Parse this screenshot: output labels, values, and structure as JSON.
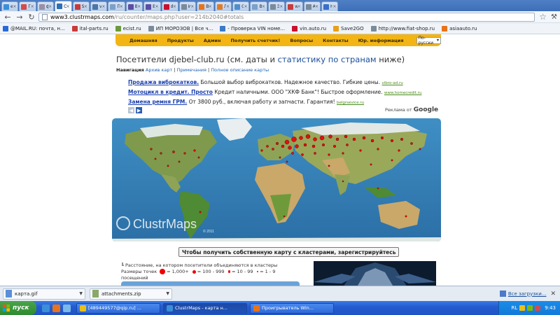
{
  "browser": {
    "tabs": [
      {
        "label": "ex",
        "color": "#3b8fd8"
      },
      {
        "label": "Гр",
        "color": "#d64a4a"
      },
      {
        "label": "фс",
        "color": "#9a8fa6"
      },
      {
        "label": "Cl",
        "color": "#2f6fb3",
        "active": true
      },
      {
        "label": "STi",
        "color": "#c93a3a"
      },
      {
        "label": "vk",
        "color": "#4a76a8"
      },
      {
        "label": "Пр",
        "color": "#7da0c8"
      },
      {
        "label": "Ва",
        "color": "#5b4ea3"
      },
      {
        "label": "Ва",
        "color": "#5b4ea3"
      },
      {
        "label": "dr",
        "color": "#c8102e"
      },
      {
        "label": "Иг",
        "color": "#7a8a9a"
      },
      {
        "label": "Во",
        "color": "#e8731a"
      },
      {
        "label": "Ли",
        "color": "#e07b2a"
      },
      {
        "label": "Са",
        "color": "#4f8fc9"
      },
      {
        "label": "Во",
        "color": "#7da0c8"
      },
      {
        "label": "Эк",
        "color": "#7a8a9a"
      },
      {
        "label": "ww",
        "color": "#c93a3a"
      },
      {
        "label": "Ав",
        "color": "#7a8a9a"
      },
      {
        "label": "Но",
        "color": "#3a6fc8"
      }
    ],
    "url_host": "www3.clustrmaps.com",
    "url_path": "/ru/counter/maps.php?user=214b2040#totals",
    "bookmarks": [
      {
        "label": "@MAIL.RU: почта, н...",
        "color": "#2a6ad8"
      },
      {
        "label": "ital-parts.ru",
        "color": "#c93a3a"
      },
      {
        "label": "ecist.ru",
        "color": "#6a9a3a"
      },
      {
        "label": "ИП МОРОЗОВ | Все ч...",
        "color": "#7a8a9a"
      },
      {
        "label": "- Проверка VIN номе...",
        "color": "#3a7ac8"
      },
      {
        "label": "vin.auto.ru",
        "color": "#c8102e"
      },
      {
        "label": "Save2GO",
        "color": "#e8a01a"
      },
      {
        "label": "http://www.fiat-shop.ru",
        "color": "#7a8a9a"
      },
      {
        "label": "asiaauto.ru",
        "color": "#e8731a"
      }
    ]
  },
  "site": {
    "nav": [
      "Домашняя",
      "Продукты",
      "Админ",
      "Получить счетчик!",
      "Вопросы",
      "Контакты",
      "Юр. информация"
    ],
    "lang_value": "По-русски",
    "title_a": "Посетители djebel-club.ru (см. даты и ",
    "title_link": "статистику по странам",
    "title_b": " ниже)",
    "nav_label": "Навигация",
    "nav_links": [
      "Архив карт",
      "Примечания",
      "Полное описание карты"
    ],
    "ads": [
      {
        "title": "Продажа виброкатков.",
        "text": " Большой выбор виброкатков. Надежное качество. Гибкие цены.",
        "url": "vibro-ad.ru"
      },
      {
        "title": "Мотоцикл в кредит. Просто",
        "text": " Кредит наличными. ООО \"ХКФ Банк\"! Быстрое оформление.",
        "url": "www.homecredit.ru"
      },
      {
        "title": "Замена ремня ГРМ.",
        "text": " От 3800 руб., включая работу и запчасти. Гарантия!",
        "url": "belgrsevice.ru"
      }
    ],
    "ads_by_prefix": "Реклама от",
    "ads_by_brand": "Google",
    "map_logo": "ClustrMaps",
    "map_copyright": "© 2011",
    "register_button": "Чтобы получить собственную карту с кластерами, зарегистрируйтесь",
    "legend_line1": "Расстояние, на котором посетители объединяются в кластеры",
    "legend_sizes_label": "Размеры точек",
    "legend_sizes": [
      "= 1,000+",
      "= 100 - 999",
      "= 10 - 99",
      "= 1 - 9"
    ],
    "legend_line3": "посещений"
  },
  "downloads": [
    {
      "name": "карта.gif"
    },
    {
      "name": "attachments.zip"
    }
  ],
  "downloads_all": "Все загрузки...",
  "taskbar": {
    "start_label": "пуск",
    "tasks": [
      {
        "label": "[489449577@qip.ru] ...",
        "color": "#e8c01a"
      },
      {
        "label": "ClustrMaps - карта н...",
        "color": "#3b8fd8",
        "active": true
      },
      {
        "label": "Проигрыватель Win...",
        "color": "#e8731a"
      }
    ],
    "tray_lang": "RL",
    "clock": "9:43"
  }
}
